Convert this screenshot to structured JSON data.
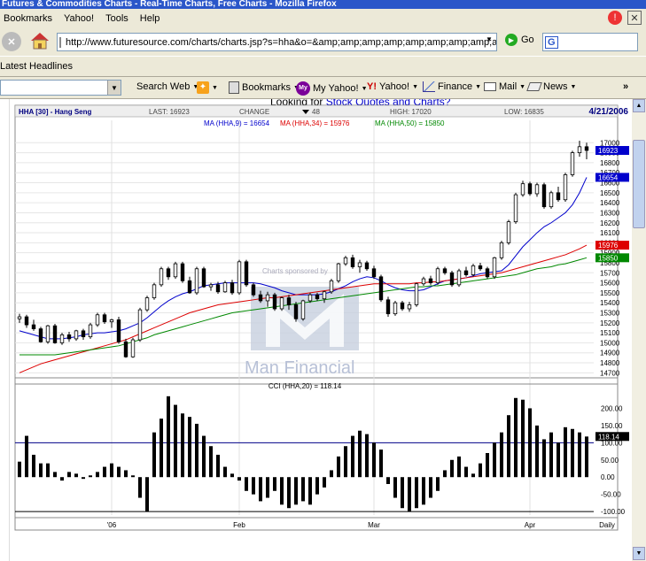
{
  "window": {
    "title": "Futures & Commodities Charts - Real-Time Charts, Free Charts - Mozilla Firefox"
  },
  "menu": {
    "items": [
      "Bookmarks",
      "Yahoo!",
      "Tools",
      "Help"
    ]
  },
  "nav": {
    "url": "http://www.futuresource.com/charts/charts.jsp?s=hha&o=&amp;amp;amp;amp;amp;amp;amp;amp;amp;a=I",
    "go_label": "Go",
    "search_letter": "G"
  },
  "bookmarks": {
    "latest_headlines": "Latest Headlines"
  },
  "yahoo_toolbar": {
    "search_web": "Search Web",
    "bookmarks": "Bookmarks",
    "my_yahoo": "My Yahoo!",
    "yahoo": "Yahoo!",
    "finance": "Finance",
    "mail": "Mail",
    "news": "News",
    "more": "»"
  },
  "page": {
    "headline_prefix": "Looking for ",
    "headline_link": "Stock Quotes and Charts?"
  },
  "colors": {
    "up_candle": "#ffffff",
    "down_candle": "#000000",
    "ma9": "#0000cc",
    "ma34": "#dd0000",
    "ma50": "#008800",
    "price_tag": "#0000cc",
    "ma34_tag": "#dd0000",
    "ma50_tag": "#008800",
    "header_text": "#000080"
  },
  "chart_header": {
    "symbol": "HHA [30] - Hang Seng",
    "last_label": "LAST:",
    "last_value": "16923",
    "change_label": "CHANGE",
    "change_value": "48",
    "high_label": "HIGH:",
    "high_value": "17020",
    "low_label": "LOW:",
    "low_value": "16835",
    "date": "4/21/2006",
    "ma9_label": "MA (HHA,9) = 16654",
    "ma34_label": "MA (HHA,34) = 15976",
    "ma50_label": "MA (HHA,50) = 15850"
  },
  "price_tags": {
    "last": "16923",
    "ma9": "16654",
    "ma34": "15976",
    "ma50": "15850"
  },
  "cci_header": {
    "label": "CCI (HHA,20) = 118.14"
  },
  "cci_tag": "118.14",
  "watermark": {
    "sponsor_text": "Charts sponsored by",
    "brand": "Man Financial"
  },
  "chart_data": [
    {
      "type": "candlestick",
      "title": "HHA [30] - Hang Seng",
      "ylim": [
        14650,
        17100
      ],
      "yticks": [
        14700,
        14800,
        14900,
        15000,
        15100,
        15200,
        15300,
        15400,
        15500,
        15600,
        15700,
        15800,
        15900,
        16000,
        16100,
        16200,
        16300,
        16400,
        16500,
        16600,
        16700,
        16800,
        16900,
        17000
      ],
      "xticks": [
        {
          "label": "'06",
          "index": 13
        },
        {
          "label": "Feb",
          "index": 31
        },
        {
          "label": "Mar",
          "index": 50
        },
        {
          "label": "Apr",
          "index": 72
        }
      ],
      "x_axis_label": "Daily",
      "grid": true,
      "candles": [
        [
          15240,
          15290,
          15200,
          15260
        ],
        [
          15260,
          15280,
          15150,
          15180
        ],
        [
          15180,
          15230,
          15120,
          15140
        ],
        [
          15140,
          15160,
          15000,
          15010
        ],
        [
          15010,
          15180,
          14990,
          15170
        ],
        [
          15170,
          15190,
          14990,
          15000
        ],
        [
          15000,
          15100,
          14980,
          15080
        ],
        [
          15080,
          15110,
          15010,
          15040
        ],
        [
          15040,
          15130,
          15020,
          15120
        ],
        [
          15120,
          15140,
          15030,
          15060
        ],
        [
          15060,
          15200,
          15040,
          15180
        ],
        [
          15180,
          15300,
          15160,
          15280
        ],
        [
          15280,
          15300,
          15190,
          15210
        ],
        [
          15210,
          15240,
          15150,
          15230
        ],
        [
          15230,
          15260,
          14990,
          15010
        ],
        [
          15010,
          15040,
          14850,
          14860
        ],
        [
          14860,
          15050,
          14850,
          15030
        ],
        [
          15030,
          15350,
          15010,
          15330
        ],
        [
          15330,
          15470,
          15310,
          15450
        ],
        [
          15450,
          15600,
          15430,
          15580
        ],
        [
          15580,
          15760,
          15560,
          15740
        ],
        [
          15740,
          15760,
          15630,
          15660
        ],
        [
          15660,
          15810,
          15640,
          15790
        ],
        [
          15790,
          15810,
          15600,
          15620
        ],
        [
          15620,
          15660,
          15490,
          15500
        ],
        [
          15500,
          15760,
          15480,
          15740
        ],
        [
          15740,
          15760,
          15550,
          15560
        ],
        [
          15560,
          15600,
          15520,
          15580
        ],
        [
          15580,
          15610,
          15490,
          15510
        ],
        [
          15510,
          15620,
          15500,
          15600
        ],
        [
          15600,
          15630,
          15480,
          15500
        ],
        [
          15500,
          15830,
          15480,
          15810
        ],
        [
          15810,
          15830,
          15560,
          15580
        ],
        [
          15580,
          15600,
          15460,
          15480
        ],
        [
          15480,
          15520,
          15400,
          15420
        ],
        [
          15420,
          15510,
          15360,
          15480
        ],
        [
          15480,
          15500,
          15320,
          15340
        ],
        [
          15340,
          15460,
          15320,
          15450
        ],
        [
          15450,
          15480,
          15330,
          15380
        ],
        [
          15380,
          15410,
          15210,
          15240
        ],
        [
          15240,
          15430,
          15220,
          15420
        ],
        [
          15420,
          15500,
          15400,
          15480
        ],
        [
          15480,
          15500,
          15420,
          15440
        ],
        [
          15440,
          15520,
          15400,
          15510
        ],
        [
          15510,
          15640,
          15490,
          15620
        ],
        [
          15620,
          15800,
          15600,
          15790
        ],
        [
          15790,
          15870,
          15770,
          15850
        ],
        [
          15850,
          15880,
          15740,
          15760
        ],
        [
          15760,
          15830,
          15700,
          15800
        ],
        [
          15800,
          15820,
          15720,
          15740
        ],
        [
          15740,
          15770,
          15640,
          15660
        ],
        [
          15660,
          15680,
          15410,
          15430
        ],
        [
          15430,
          15460,
          15260,
          15290
        ],
        [
          15290,
          15420,
          15270,
          15400
        ],
        [
          15400,
          15420,
          15320,
          15340
        ],
        [
          15340,
          15410,
          15310,
          15380
        ],
        [
          15380,
          15600,
          15360,
          15590
        ],
        [
          15590,
          15660,
          15570,
          15640
        ],
        [
          15640,
          15670,
          15580,
          15600
        ],
        [
          15600,
          15760,
          15580,
          15740
        ],
        [
          15740,
          15760,
          15680,
          15700
        ],
        [
          15700,
          15720,
          15560,
          15580
        ],
        [
          15580,
          15740,
          15560,
          15720
        ],
        [
          15720,
          15760,
          15660,
          15680
        ],
        [
          15680,
          15790,
          15660,
          15770
        ],
        [
          15770,
          15800,
          15720,
          15740
        ],
        [
          15740,
          15760,
          15640,
          15660
        ],
        [
          15660,
          15860,
          15640,
          15850
        ],
        [
          15850,
          16020,
          15830,
          16000
        ],
        [
          16000,
          16230,
          15980,
          16210
        ],
        [
          16210,
          16500,
          16190,
          16480
        ],
        [
          16480,
          16620,
          16460,
          16590
        ],
        [
          16590,
          16610,
          16470,
          16490
        ],
        [
          16490,
          16600,
          16460,
          16580
        ],
        [
          16580,
          16600,
          16340,
          16360
        ],
        [
          16360,
          16520,
          16340,
          16500
        ],
        [
          16500,
          16560,
          16410,
          16430
        ],
        [
          16430,
          16700,
          16410,
          16680
        ],
        [
          16680,
          16920,
          16660,
          16900
        ],
        [
          16900,
          17020,
          16860,
          16960
        ],
        [
          16960,
          17000,
          16835,
          16923
        ]
      ],
      "moving_averages": [
        {
          "name": "MA (HHA,9)",
          "start": 0,
          "values": [
            15120,
            15100,
            15080,
            15060,
            15040,
            15040,
            15040,
            15050,
            15060,
            15080,
            15090,
            15100,
            15100,
            15110,
            15120,
            15140,
            15170,
            15200,
            15250,
            15310,
            15370,
            15420,
            15460,
            15490,
            15510,
            15540,
            15570,
            15580,
            15590,
            15600,
            15600,
            15600,
            15600,
            15600,
            15590,
            15570,
            15550,
            15520,
            15500,
            15480,
            15480,
            15480,
            15480,
            15490,
            15510,
            15540,
            15570,
            15610,
            15640,
            15660,
            15650,
            15620,
            15580,
            15550,
            15530,
            15520,
            15520,
            15530,
            15560,
            15590,
            15620,
            15630,
            15640,
            15650,
            15670,
            15690,
            15700,
            15710,
            15720,
            15780,
            15870,
            15960,
            16030,
            16100,
            16160,
            16200,
            16250,
            16300,
            16380,
            16500,
            16654
          ]
        },
        {
          "name": "MA (HHA,34)",
          "start": 0,
          "values": [
            14700,
            14730,
            14760,
            14790,
            14810,
            14830,
            14850,
            14870,
            14890,
            14910,
            14930,
            14950,
            14970,
            14990,
            15010,
            15030,
            15060,
            15090,
            15120,
            15150,
            15180,
            15210,
            15240,
            15270,
            15300,
            15320,
            15340,
            15360,
            15380,
            15390,
            15400,
            15410,
            15420,
            15430,
            15440,
            15450,
            15450,
            15460,
            15470,
            15480,
            15490,
            15500,
            15510,
            15520,
            15530,
            15540,
            15550,
            15560,
            15570,
            15580,
            15590,
            15590,
            15590,
            15590,
            15590,
            15590,
            15600,
            15600,
            15610,
            15610,
            15620,
            15630,
            15640,
            15650,
            15660,
            15670,
            15680,
            15690,
            15700,
            15720,
            15740,
            15760,
            15780,
            15800,
            15820,
            15840,
            15860,
            15880,
            15910,
            15940,
            15976
          ]
        },
        {
          "name": "MA (HHA,50)",
          "start": 0,
          "values": [
            14880,
            14880,
            14880,
            14880,
            14880,
            14880,
            14890,
            14900,
            14910,
            14920,
            14930,
            14940,
            14950,
            14960,
            14970,
            14990,
            15010,
            15030,
            15050,
            15080,
            15100,
            15120,
            15140,
            15160,
            15180,
            15200,
            15220,
            15240,
            15260,
            15280,
            15300,
            15310,
            15320,
            15330,
            15340,
            15350,
            15360,
            15370,
            15380,
            15390,
            15400,
            15410,
            15420,
            15430,
            15440,
            15450,
            15460,
            15470,
            15480,
            15490,
            15500,
            15510,
            15520,
            15530,
            15540,
            15550,
            15560,
            15560,
            15570,
            15570,
            15580,
            15590,
            15600,
            15610,
            15620,
            15630,
            15640,
            15650,
            15660,
            15670,
            15680,
            15700,
            15720,
            15740,
            15750,
            15760,
            15780,
            15790,
            15810,
            15830,
            15850
          ]
        }
      ]
    },
    {
      "type": "bar",
      "title": "CCI (HHA,20) = 118.14",
      "ylim": [
        -110,
        250
      ],
      "yticks": [
        -100,
        -50,
        0,
        50,
        100,
        150,
        200
      ],
      "ytick_labels": [
        "-100.00",
        "-50.00",
        "0.00",
        "50.00",
        "100.00",
        "150.00",
        "200.00"
      ],
      "reference_lines": [
        100,
        -100
      ],
      "values": [
        45,
        120,
        65,
        40,
        40,
        15,
        -10,
        15,
        10,
        -5,
        5,
        15,
        30,
        40,
        30,
        20,
        5,
        -60,
        -100,
        130,
        170,
        235,
        210,
        185,
        175,
        155,
        120,
        90,
        65,
        30,
        10,
        -10,
        -40,
        -50,
        -70,
        -60,
        -40,
        -80,
        -90,
        -80,
        -70,
        -80,
        -50,
        -30,
        20,
        60,
        90,
        120,
        135,
        125,
        100,
        80,
        -20,
        -60,
        -90,
        -100,
        -90,
        -80,
        -60,
        -40,
        20,
        50,
        60,
        30,
        10,
        40,
        70,
        100,
        130,
        180,
        230,
        225,
        200,
        150,
        110,
        130,
        100,
        145,
        140,
        130,
        118
      ]
    }
  ]
}
